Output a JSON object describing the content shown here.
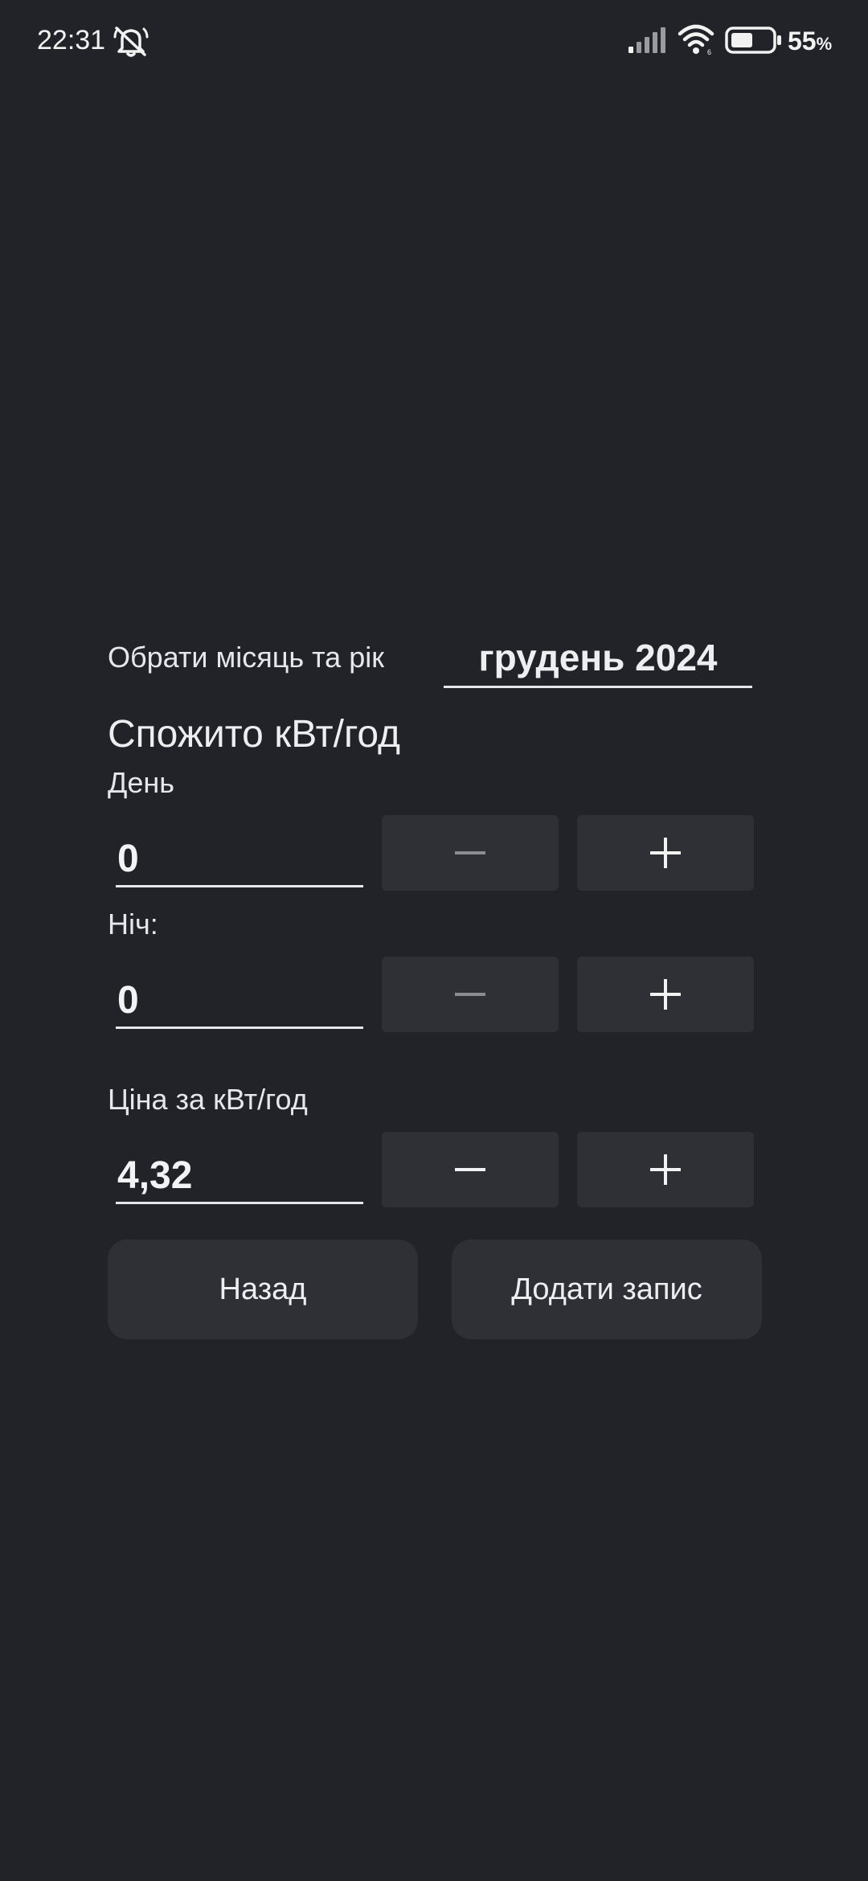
{
  "status_bar": {
    "time": "22:31",
    "battery_percent": "55",
    "battery_suffix": "%",
    "battery_level": 0.55,
    "icons": [
      "mute-icon",
      "signal-icon",
      "wifi-icon",
      "battery-icon"
    ]
  },
  "form": {
    "select_period_label": "Обрати місяць та рік",
    "selected_period": "грудень 2024",
    "consumed_title": "Спожито кВт/год",
    "day": {
      "label": "День",
      "value": "0",
      "minus_enabled": false,
      "plus_enabled": true
    },
    "night": {
      "label": "Ніч:",
      "value": "0",
      "minus_enabled": false,
      "plus_enabled": true
    },
    "price": {
      "label": "Ціна за кВт/год",
      "value": "4,32",
      "minus_enabled": true,
      "plus_enabled": true
    }
  },
  "actions": {
    "back_label": "Назад",
    "add_label": "Додати запис"
  },
  "colors": {
    "background": "#212328",
    "button": "#2e3036",
    "text": "#e6e7ea",
    "disabled_icon": "#8a8c91"
  }
}
